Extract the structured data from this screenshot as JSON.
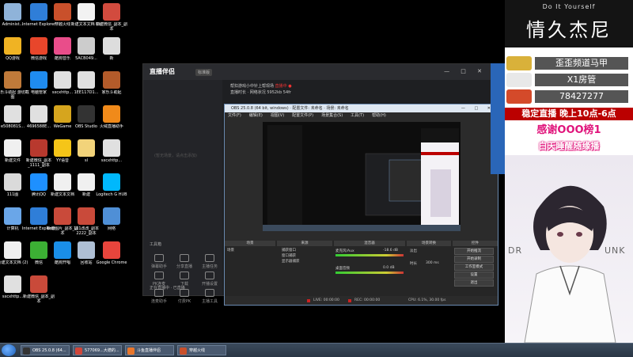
{
  "desktop_icons": [
    {
      "label": "Administ...",
      "color": "#8fb3d9"
    },
    {
      "label": "Internet Explorer",
      "color": "#2f7ed8"
    },
    {
      "label": "穿越火线",
      "color": "#c9502b"
    },
    {
      "label": "新建文本文档 (3)",
      "color": "#f2f2f2"
    },
    {
      "label": "新建微信_副本_副本",
      "color": "#d24b3e"
    },
    {
      "label": "QQ游戏",
      "color": "#f0b323"
    },
    {
      "label": "微信游戏",
      "color": "#e8462b"
    },
    {
      "label": "酷狗音乐",
      "color": "#e94d8a"
    },
    {
      "label": "5ACB049...",
      "color": "#cccccc"
    },
    {
      "label": "新",
      "color": "#dddddd"
    },
    {
      "label": "家乐斗助起 游坊截图",
      "color": "#c07a3a"
    },
    {
      "label": "电脑管家",
      "color": "#1f8cf0"
    },
    {
      "label": "sxcxhttp...",
      "color": "#e0e0e0"
    },
    {
      "label": "1EE117D1...",
      "color": "#e0e0e0"
    },
    {
      "label": "家乐斗助起",
      "color": "#b35b2a"
    },
    {
      "label": "e508081S...",
      "color": "#e0e0e0"
    },
    {
      "label": "4696588E...",
      "color": "#e0e0e0"
    },
    {
      "label": "WeGame",
      "color": "#d6a51e"
    },
    {
      "label": "OBS Studio",
      "color": "#333333"
    },
    {
      "label": "火绒直播助手",
      "color": "#f08a1a"
    },
    {
      "label": "新建文件",
      "color": "#f0f0f0"
    },
    {
      "label": "新建微信_副本_1111_副本",
      "color": "#b8392e"
    },
    {
      "label": "YY语音",
      "color": "#f5c518"
    },
    {
      "label": "sl",
      "color": "#f2d37a"
    },
    {
      "label": "sxcxhttp...",
      "color": "#e0e0e0"
    },
    {
      "label": "111图",
      "color": "#dadada"
    },
    {
      "label": "腾讯QQ",
      "color": "#1e90ff"
    },
    {
      "label": "新建文本文档",
      "color": "#f0f0f0"
    },
    {
      "label": "新建",
      "color": "#f0f0f0"
    },
    {
      "label": "Logitech G HUB",
      "color": "#00b8fc"
    },
    {
      "label": "计算机",
      "color": "#6aa6e8"
    },
    {
      "label": "Internet Explorer",
      "color": "#2f7ed8"
    },
    {
      "label": "新建图片_副本_副本",
      "color": "#c94a3a"
    },
    {
      "label": "111改改_副本2222_副本",
      "color": "#c94a3a"
    },
    {
      "label": "网络",
      "color": "#4f8fd6"
    },
    {
      "label": "新建文本文档 (2)",
      "color": "#f0f0f0"
    },
    {
      "label": "微信",
      "color": "#3cb034"
    },
    {
      "label": "酷狗开唱",
      "color": "#1a8fe8"
    },
    {
      "label": "回收站",
      "color": "#aebfd4"
    },
    {
      "label": "Google Chrome",
      "color": "#e8453c"
    },
    {
      "label": "sxcxhttp...",
      "color": "#e0e0e0"
    },
    {
      "label": "新建微信_副本_副本",
      "color": "#c94a3a"
    }
  ],
  "zhibo_window": {
    "title": "直播伴侣",
    "badge": "标准版",
    "controls": "— □ ✕",
    "placeholder": "(暂无场景，请点击添加)",
    "info_line1": "帮扣游戏小中针上帮现场",
    "info_red": "直播中 ●",
    "info_line2": "直播时长 · 网络状况",
    "info_val": "5952kb  54fr",
    "tools_title": "工具箱",
    "tools": [
      {
        "label": "弹幕助手"
      },
      {
        "label": "分享直播"
      },
      {
        "label": "主播任务"
      },
      {
        "label": "PK连麦"
      },
      {
        "label": "下载"
      },
      {
        "label": "开播设置"
      },
      {
        "label": "连麦助手"
      },
      {
        "label": "付费PK"
      },
      {
        "label": "主播工具"
      }
    ],
    "bottom_status": "正在直播中 · 已直播"
  },
  "obs": {
    "title": "OBS 25.0.8 (64 bit, windows) · 配置文件: 未命名 · 场景: 未命名",
    "controls": "— □ ✕",
    "menu": [
      "文件(F)",
      "编辑(E)",
      "视图(V)",
      "配置文件(P)",
      "场景集合(S)",
      "工具(T)",
      "帮助(H)"
    ],
    "docks": [
      "场景",
      "来源",
      "混音器",
      "场景转换",
      "控件"
    ],
    "scene": "场景",
    "sources": [
      "捕获窗口",
      "窗口捕获",
      "显示器捕获"
    ],
    "mixer": [
      {
        "label": "麦克风/Aux",
        "db": "-18.6 dB"
      },
      {
        "label": "桌面音频",
        "db": "0.0 dB"
      }
    ],
    "transition": "淡出",
    "duration": "时长",
    "duration_val": "300 ms",
    "controls_buttons": [
      "开始推流",
      "开始录制",
      "工作室模式",
      "设置",
      "退出"
    ],
    "status": {
      "live": "LIVE: 00:00:00",
      "rec": "REC: 00:00:00",
      "cpu": "CPU: 6.1%, 30.00 fps"
    }
  },
  "right_panel": {
    "diy": "Do It Yourself",
    "name": "情久杰尼",
    "ranks": [
      {
        "name": "歪歪频道马甲",
        "color": "#d9b13a"
      },
      {
        "name": "X1房管",
        "color": "#e8e8e8"
      },
      {
        "name": "78427277",
        "color": "#d44a2a"
      }
    ],
    "notice1": "稳定直播  晚上10点-6点",
    "notice2": "感谢OOO榜1",
    "notice3": "白天睡醒随缘播",
    "portrait_left": "DR",
    "portrait_right": "UNK"
  },
  "taskbar": {
    "items": [
      {
        "label": "OBS 25.0.8 (64...",
        "color": "#333333"
      },
      {
        "label": "577069...大德的...",
        "color": "#d0463a"
      },
      {
        "label": "斗鱼直播伴侣",
        "color": "#e8762b"
      },
      {
        "label": "穿越火线",
        "color": "#c9502b"
      }
    ]
  }
}
